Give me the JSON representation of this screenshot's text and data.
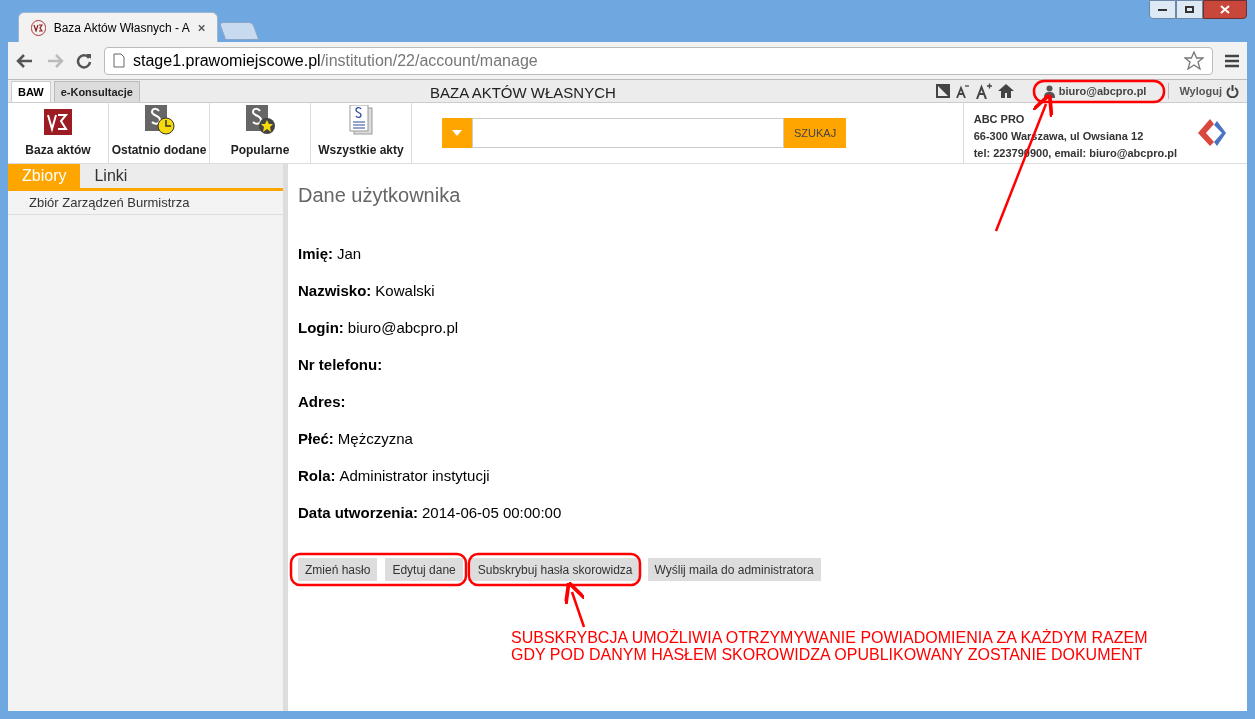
{
  "browser": {
    "tab_title": "Baza Aktów Własnych - A",
    "url_host": "stage1.prawomiejscowe.pl",
    "url_path": "/institution/22/account/manage"
  },
  "app_tabs": [
    {
      "label": "BAW",
      "selected": true
    },
    {
      "label": "e-Konsultacje",
      "selected": false
    }
  ],
  "header_title": "BAZA AKTÓW WŁASNYCH",
  "user": "biuro@abcpro.pl",
  "logout": "Wyloguj",
  "toolbar": [
    {
      "kind": "logo",
      "label": "Baza aktów"
    },
    {
      "kind": "recent",
      "label": "Ostatnio dodane"
    },
    {
      "kind": "popular",
      "label": "Popularne"
    },
    {
      "kind": "all",
      "label": "Wszystkie akty"
    }
  ],
  "search": {
    "button": "SZUKAJ"
  },
  "organization": {
    "name": "ABC PRO",
    "address": "66-300 Warszawa, ul Owsiana 12",
    "contact": "tel: 223790900, email: biuro@abcpro.pl"
  },
  "sidebar": {
    "tabs": [
      {
        "label": "Zbiory",
        "selected": true
      },
      {
        "label": "Linki",
        "selected": false
      }
    ],
    "items": [
      "Zbiór Zarządzeń Burmistrza"
    ]
  },
  "page_title": "Dane użytkownika",
  "fields": [
    {
      "label": "Imię:",
      "value": "Jan"
    },
    {
      "label": "Nazwisko:",
      "value": "Kowalski"
    },
    {
      "label": "Login:",
      "value": "biuro@abcpro.pl"
    },
    {
      "label": "Nr telefonu:"
    },
    {
      "label": "Adres:"
    },
    {
      "label": "Płeć:",
      "value": "Mężczyzna"
    },
    {
      "label": "Rola:",
      "value": "Administrator instytucji"
    },
    {
      "label": "Data utworzenia:",
      "value": "2014-06-05 00:00:00"
    }
  ],
  "buttons": [
    "Zmień hasło",
    "Edytuj dane",
    "Subskrybuj hasła skorowidza",
    "Wyślij maila do administratora"
  ],
  "annotation": [
    "SUBSKRYBCJA UMOŻLIWIA OTRZYMYWANIE POWIADOMIENIA ZA KAŻDYM RAZEM",
    "GDY POD DANYM HASŁEM SKOROWIDZA OPUBLIKOWANY ZOSTANIE DOKUMENT"
  ]
}
